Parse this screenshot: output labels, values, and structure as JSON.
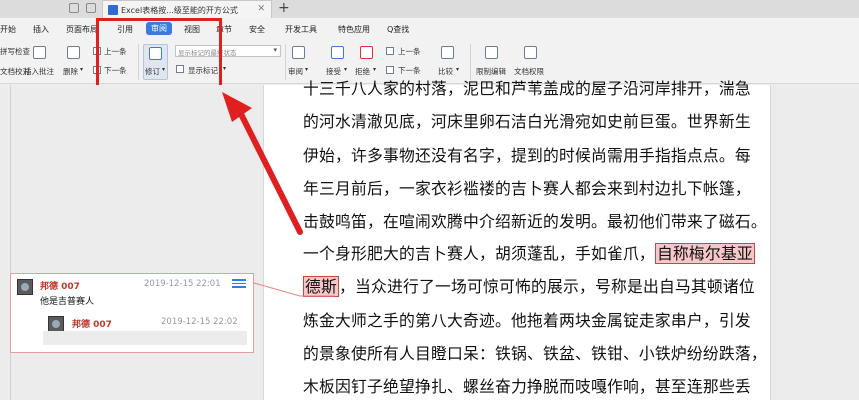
{
  "titlebar": {
    "doc_tab_title": "Excel表格按...级至能的开方公式",
    "new_tab": "+"
  },
  "menu": {
    "items": [
      "开始",
      "插入",
      "页面布局",
      "引用",
      "审阅",
      "视图",
      "章节",
      "安全",
      "开发工具",
      "特色应用",
      "Q查找"
    ],
    "active": "审阅"
  },
  "ribbon": {
    "left_cut_1": "拼写检查",
    "left_cut_2": "文档校对",
    "insert_comment": "插入批注",
    "delete": "删除",
    "prev_comment": "上一条",
    "next_comment": "下一条",
    "revise": "修订",
    "markup_select": "显示标记的最终状态",
    "show_markup": "显示标记",
    "review": "审阅",
    "accept": "接受",
    "reject": "拒绝",
    "prev_change": "上一条",
    "next_change": "下一条",
    "compare": "比较",
    "restrict_edit": "限制编辑",
    "doc_permission": "文档权限"
  },
  "document": {
    "lines": [
      "十三千八人家的村落，泥巴和芦苇盖成的屋子沿河岸排开，湍急",
      "的河水清澈见底，河床里卵石洁白光滑宛如史前巨蛋。世界新生",
      "伊始，许多事物还没有名字，提到的时候尚需用手指指点点。每",
      "年三月前后，一家衣衫褴褛的吉卜赛人都会来到村边扎下帐篷，",
      "击鼓鸣笛，在喧闹欢腾中介绍新近的发明。最初他们带来了磁石。",
      "一个身形肥大的吉卜赛人，胡须蓬乱，手如雀爪，",
      "德斯",
      "，当众进行了一场可惊可怖的展示，号称是出自马其顿诸位",
      "炼金大师之手的第八大奇迹。他拖着两块金属锭走家串户，引发",
      "的景象使所有人目瞪口呆：铁锅、铁盆、铁钳、小铁炉纷纷跌落，",
      "木板因钉子绝望挣扎、螺丝奋力挣脱而吱嘎作响，甚至连那些丢"
    ],
    "highlight_1": "自称梅尔基亚",
    "highlight_2": "德斯"
  },
  "comment": {
    "author": "邦德 007",
    "date": "2019-12-15 22:01",
    "text": "他是吉普赛人",
    "reply_author": "邦德 007",
    "reply_date": "2019-12-15 22:02"
  },
  "colors": {
    "accent": "#3a7be0",
    "highlight_box": "#e02020",
    "comment_author": "#c0392b"
  }
}
